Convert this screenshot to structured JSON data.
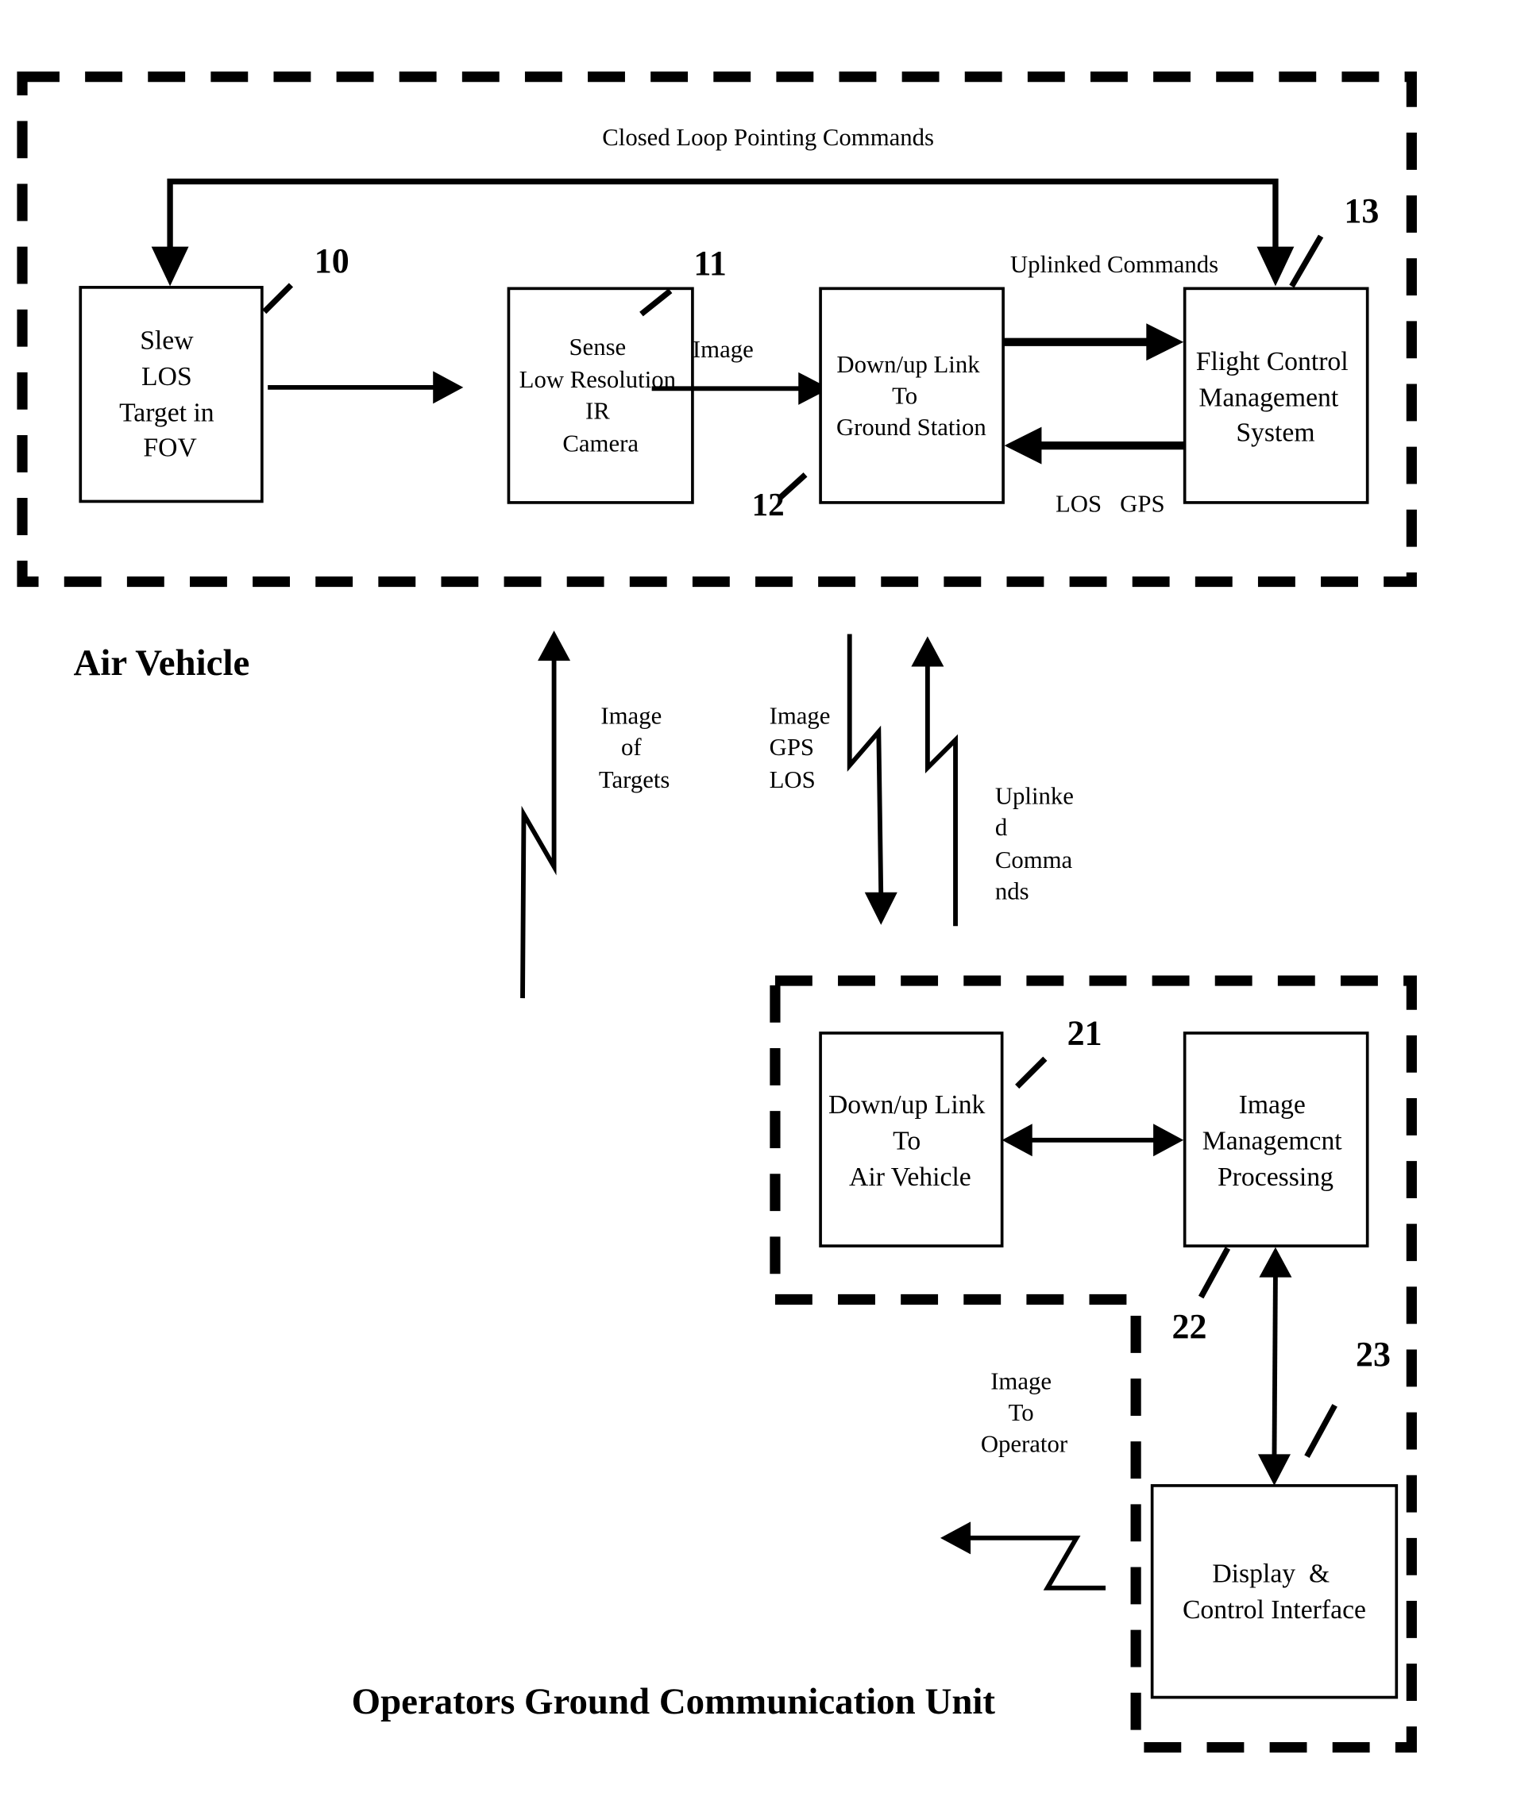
{
  "diagram": {
    "regions": {
      "air_vehicle": {
        "title": "Air Vehicle"
      },
      "ground_unit": {
        "title": "Operators Ground Communication Unit"
      }
    },
    "blocks": {
      "slew": {
        "ref": "10",
        "lines": [
          "Slew",
          "LOS",
          "Target in",
          "FOV"
        ]
      },
      "camera": {
        "ref": "11",
        "lines": [
          "Sense",
          "Low Resolution",
          "IR",
          "Camera"
        ]
      },
      "downlink_ground": {
        "ref": "12",
        "lines": [
          "Down/up  Link",
          "To",
          "Ground Station"
        ]
      },
      "flight_control": {
        "ref": "13",
        "lines": [
          "Flight Control",
          "Management",
          "System"
        ]
      },
      "downlink_air": {
        "ref": "21",
        "lines": [
          "Down/up Link",
          "To",
          "Air Vehicle"
        ]
      },
      "image_mgmt": {
        "ref": "22",
        "lines": [
          "Image",
          "Managemcnt",
          "Processing"
        ]
      },
      "display": {
        "ref": "23",
        "lines": [
          "Display  &",
          "Control Interface"
        ]
      }
    },
    "labels": {
      "closed_loop": "Closed Loop Pointing Commands",
      "uplinked_commands_top": "Uplinked Commands",
      "image_arrow": "Image",
      "los_gps": "LOS   GPS",
      "image_of_targets": [
        "Image",
        "of",
        "Targets"
      ],
      "image_gps_los": [
        "Image",
        "GPS",
        "LOS"
      ],
      "uplinked_commands_link": [
        "Uplinke",
        "d",
        "Comma",
        "nds"
      ],
      "image_to_operator": [
        "Image",
        "To",
        "Operator"
      ]
    }
  }
}
